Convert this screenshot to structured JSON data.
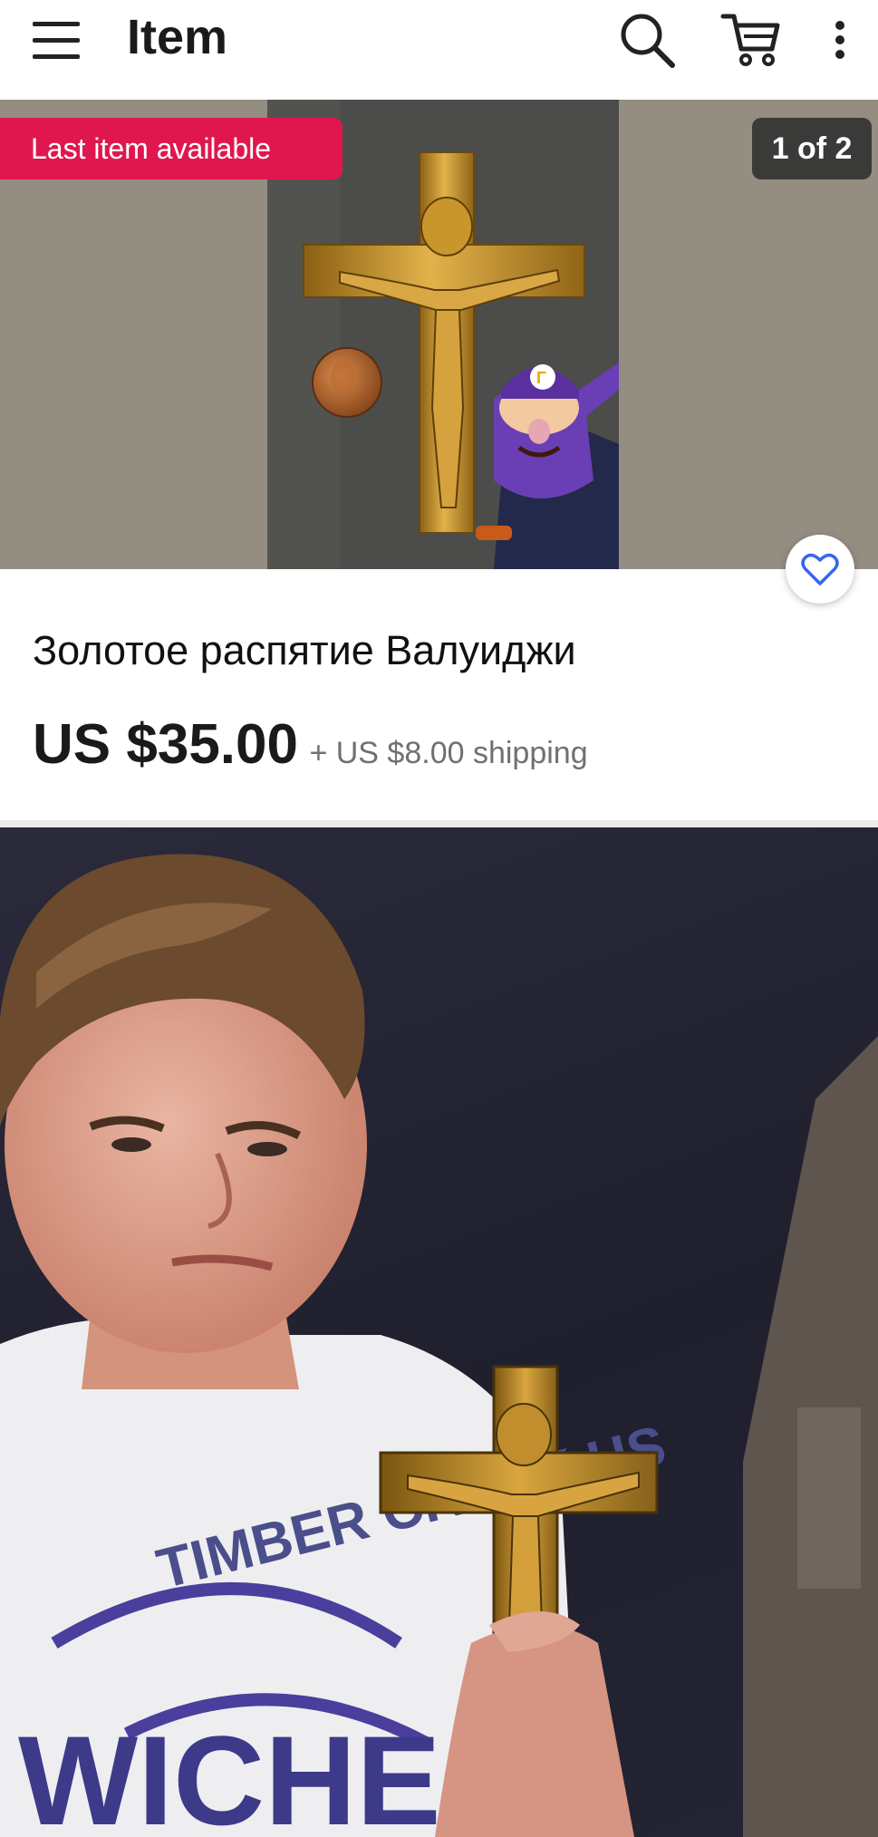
{
  "header": {
    "title": "Item"
  },
  "gallery": {
    "badge": "Last item available",
    "counter": "1 of 2"
  },
  "listing": {
    "title": "Золотое распятие Валуиджи",
    "price": "US $35.00",
    "shipping": "+ US $8.00 shipping"
  },
  "meme_text": {
    "shirt_top": "TIMBER CREEK HS",
    "shirt_mid": "WICHE"
  },
  "colors": {
    "badge_red": "#e0174f",
    "counter_bg": "#3a3a38",
    "gold": "#c8962a",
    "waluigi_purple": "#6a3fb5"
  }
}
